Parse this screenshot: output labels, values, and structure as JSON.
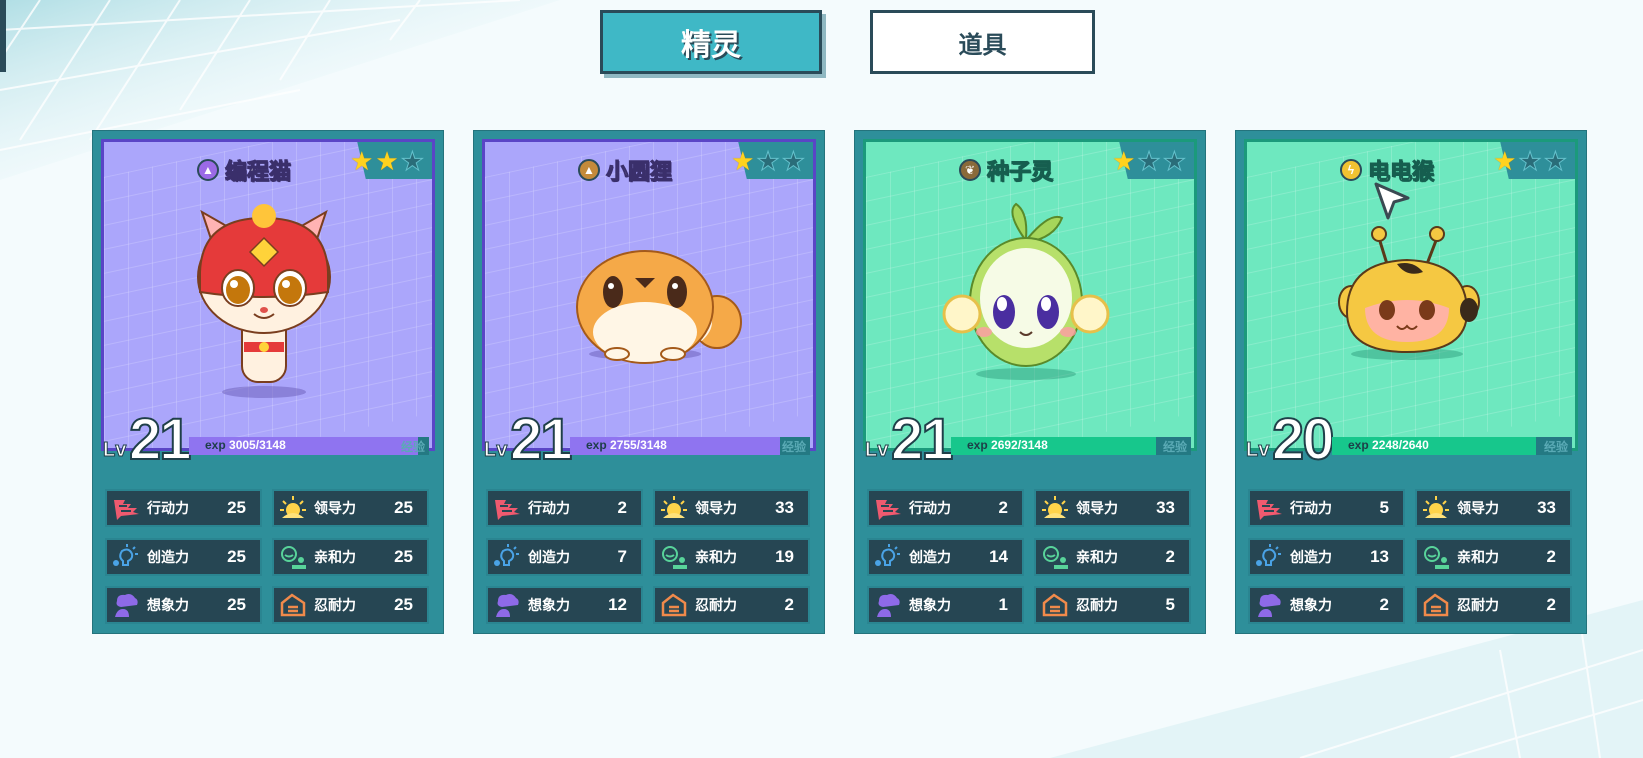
{
  "tabs": [
    {
      "label": "精灵",
      "active": true
    },
    {
      "label": "道具",
      "active": false
    }
  ],
  "exp_label": "exp",
  "exp_tag": "经验",
  "lv_prefix": "Lv",
  "stat_labels": {
    "action": "行动力",
    "leadership": "领导力",
    "creativity": "创造力",
    "affinity": "亲和力",
    "imagination": "想象力",
    "endurance": "忍耐力"
  },
  "cards": [
    {
      "name": "编程猫",
      "theme": "purple",
      "element_color": "#9b6ae6",
      "element_icon": "triangle-icon",
      "stars_filled": 2,
      "stars_total": 3,
      "level": "21",
      "exp_current": "3005",
      "exp_max": "/3148",
      "exp_ratio": 0.955,
      "stats": {
        "action": "25",
        "leadership": "25",
        "creativity": "25",
        "affinity": "25",
        "imagination": "25",
        "endurance": "25"
      }
    },
    {
      "name": "小圆狸",
      "theme": "purple",
      "element_color": "#c48a3a",
      "element_icon": "mountain-icon",
      "stars_filled": 1,
      "stars_total": 3,
      "level": "21",
      "exp_current": "2755",
      "exp_max": "/3148",
      "exp_ratio": 0.875,
      "stats": {
        "action": "2",
        "leadership": "33",
        "creativity": "7",
        "affinity": "19",
        "imagination": "12",
        "endurance": "2"
      }
    },
    {
      "name": "种子灵",
      "theme": "green",
      "element_color": "#8a6a3a",
      "element_icon": "leaf-icon",
      "stars_filled": 1,
      "stars_total": 3,
      "level": "21",
      "exp_current": "2692",
      "exp_max": "/3148",
      "exp_ratio": 0.855,
      "stats": {
        "action": "2",
        "leadership": "33",
        "creativity": "14",
        "affinity": "2",
        "imagination": "1",
        "endurance": "5"
      }
    },
    {
      "name": "电电猴",
      "theme": "green",
      "element_color": "#f1c232",
      "element_icon": "lightning-icon",
      "stars_filled": 1,
      "stars_total": 3,
      "level": "20",
      "exp_current": "2248",
      "exp_max": "/2640",
      "exp_ratio": 0.85,
      "stats": {
        "action": "5",
        "leadership": "33",
        "creativity": "13",
        "affinity": "2",
        "imagination": "2",
        "endurance": "2"
      }
    }
  ]
}
